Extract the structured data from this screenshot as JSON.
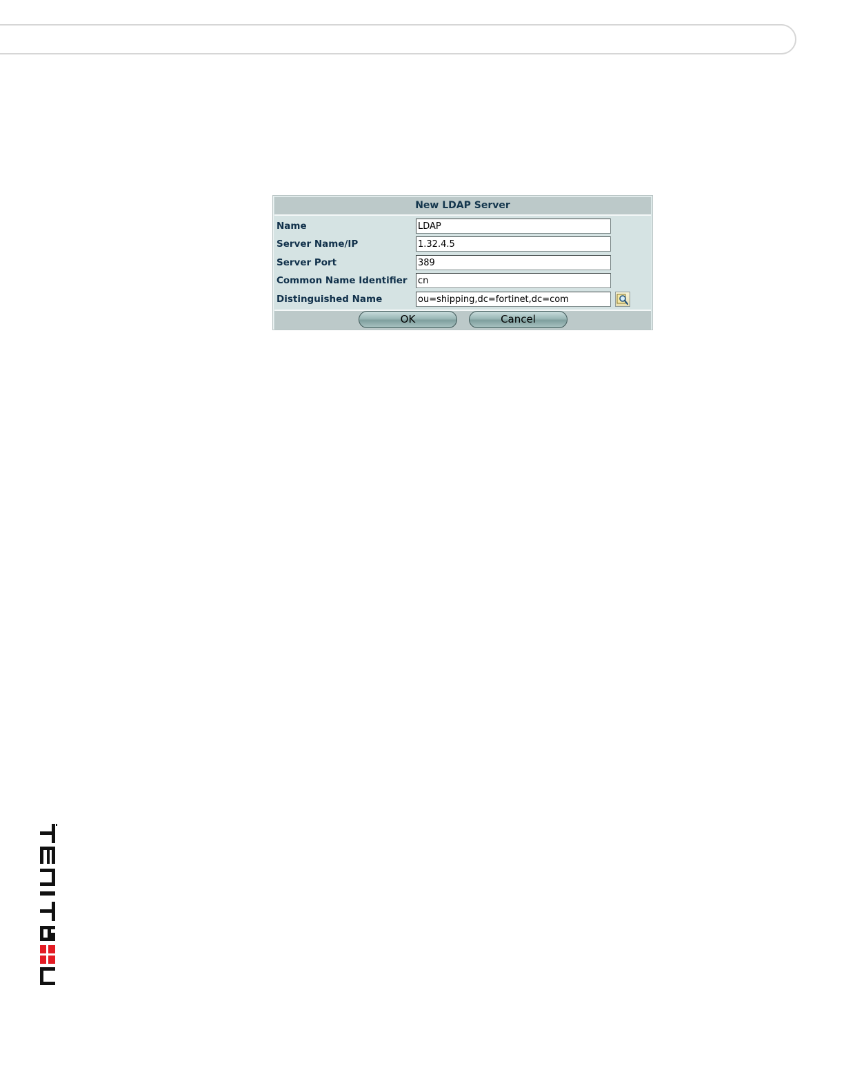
{
  "dialog": {
    "title": "New LDAP Server",
    "fields": [
      {
        "label": "Name",
        "value": "LDAP"
      },
      {
        "label": "Server Name/IP",
        "value": "1.32.4.5"
      },
      {
        "label": "Server Port",
        "value": "389"
      },
      {
        "label": "Common Name Identifier",
        "value": "cn"
      },
      {
        "label": "Distinguished Name",
        "value": "ou=shipping,dc=fortinet,dc=com"
      }
    ],
    "browse_icon": "query-browse-icon",
    "ok_label": "OK",
    "cancel_label": "Cancel"
  },
  "logo": {
    "text": "FORTINET",
    "accent_color": "#e31b23"
  }
}
